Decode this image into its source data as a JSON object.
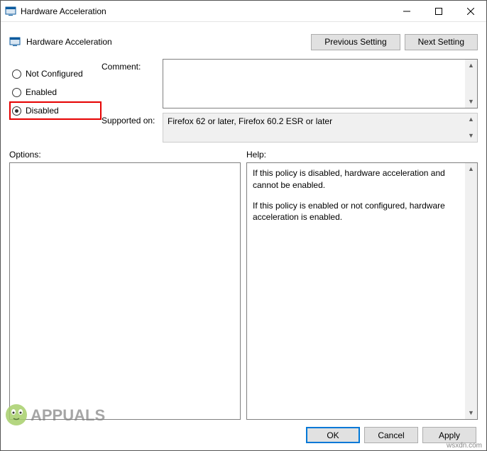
{
  "window": {
    "title": "Hardware Acceleration"
  },
  "header": {
    "title": "Hardware Acceleration",
    "prev_btn": "Previous Setting",
    "next_btn": "Next Setting"
  },
  "radios": {
    "not_configured": "Not Configured",
    "enabled": "Enabled",
    "disabled": "Disabled",
    "selected": "disabled"
  },
  "fields": {
    "comment_label": "Comment:",
    "comment_value": "",
    "supported_label": "Supported on:",
    "supported_value": "Firefox 62 or later, Firefox 60.2 ESR or later"
  },
  "panes": {
    "options_label": "Options:",
    "help_label": "Help:",
    "help_p1": "If this policy is disabled, hardware acceleration and cannot be enabled.",
    "help_p2": "If this policy is enabled or not configured, hardware acceleration is enabled."
  },
  "buttons": {
    "ok": "OK",
    "cancel": "Cancel",
    "apply": "Apply"
  },
  "watermark": "wsxdn.com",
  "logo_text": "APPUALS"
}
